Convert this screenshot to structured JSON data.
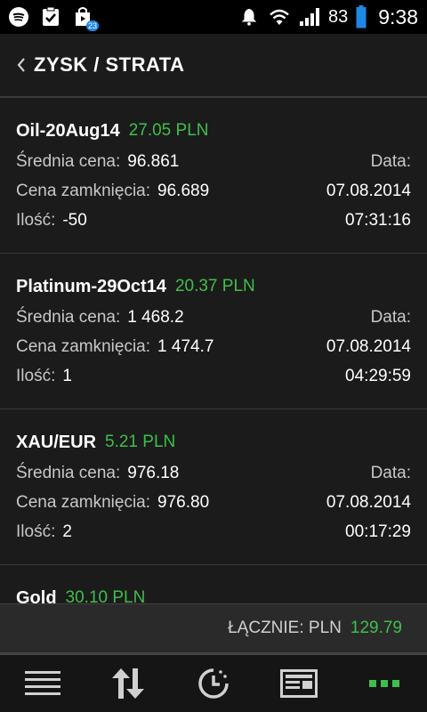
{
  "status_bar": {
    "battery_percent": "83",
    "time": "9:38",
    "icons": [
      "spotify-icon",
      "clipboard-check-icon",
      "play-store-icon",
      "bell-icon",
      "wifi-icon",
      "signal-icon",
      "battery-icon"
    ],
    "play_store_badge": "23"
  },
  "header": {
    "title": "ZYSK / STRATA"
  },
  "labels": {
    "avg_price": "Średnia cena:",
    "close_price": "Cena zamknięcia:",
    "quantity": "Ilość:",
    "date": "Data:"
  },
  "positions": [
    {
      "name": "Oil-20Aug14",
      "pnl": "27.05 PLN",
      "avg_price": "96.861",
      "close_price": "96.689",
      "quantity": "-50",
      "date": "07.08.2014",
      "time": "07:31:16"
    },
    {
      "name": "Platinum-29Oct14",
      "pnl": "20.37 PLN",
      "avg_price": "1 468.2",
      "close_price": "1 474.7",
      "quantity": "1",
      "date": "07.08.2014",
      "time": "04:29:59"
    },
    {
      "name": "XAU/EUR",
      "pnl": "5.21 PLN",
      "avg_price": "976.18",
      "close_price": "976.80",
      "quantity": "2",
      "date": "07.08.2014",
      "time": "00:17:29"
    },
    {
      "name": "Gold",
      "pnl": "30.10 PLN"
    }
  ],
  "total": {
    "label": "ŁĄCZNIE: PLN",
    "value": "129.79"
  },
  "colors": {
    "accent_green": "#3fbf4a",
    "background": "#1b1b1b"
  },
  "bottom_nav": [
    "menu-icon",
    "sort-icon",
    "history-icon",
    "news-icon",
    "more-icon"
  ]
}
